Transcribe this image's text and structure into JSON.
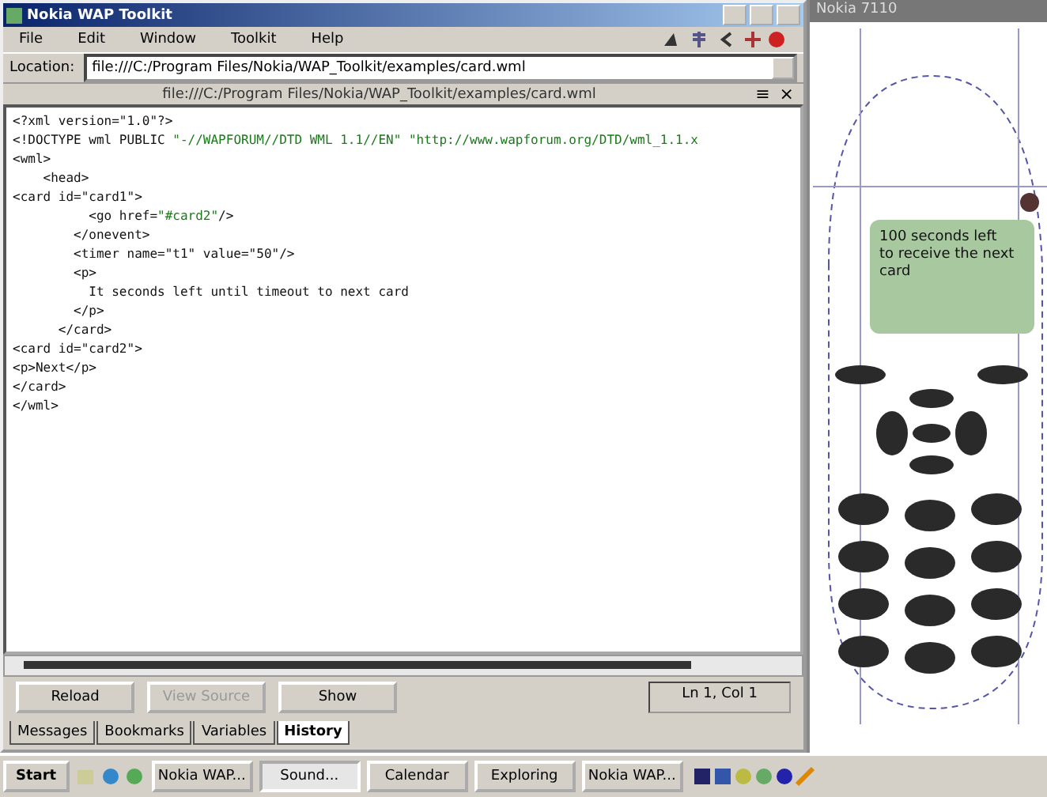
{
  "window": {
    "title": "Nokia WAP Toolkit"
  },
  "menu": [
    "File",
    "Edit",
    "Window",
    "Toolkit",
    "Help"
  ],
  "location": {
    "label": "Location:",
    "value": "file:///C:/Program Files/Nokia/WAP_Toolkit/examples/card.wml"
  },
  "document": {
    "title": "file:///C:/Program Files/Nokia/WAP_Toolkit/examples/card.wml",
    "menu_glyph": "≡",
    "close_glyph": "×"
  },
  "lines": [
    {
      "parts": [
        {
          "kind": "markup",
          "text": "<?xml version=\"1.0\"?>"
        }
      ]
    },
    {
      "parts": [
        {
          "kind": "markup",
          "text": "<!DOCTYPE wml PUBLIC "
        },
        {
          "kind": "string",
          "text": "\"-//WAPFORUM//DTD WML 1.1//EN\" \"http://www.wapforum.org/DTD/wml_1.1.x"
        }
      ]
    },
    {
      "parts": [
        {
          "kind": "markup",
          "text": "<wml>"
        }
      ]
    },
    {
      "parts": [
        {
          "kind": "markup",
          "text": "    <head>"
        }
      ]
    },
    {
      "parts": [
        {
          "kind": "markup",
          "text": "<card id=\"card1\">"
        }
      ]
    },
    {
      "parts": [
        {
          "kind": "markup",
          "text": "          <go href="
        },
        {
          "kind": "string",
          "text": "\"#card2\""
        },
        {
          "kind": "markup",
          "text": "/>"
        }
      ]
    },
    {
      "parts": [
        {
          "kind": "markup",
          "text": "        </onevent>"
        }
      ]
    },
    {
      "parts": [
        {
          "kind": "markup",
          "text": "        <timer name=\"t1\" value=\"50\"/>"
        }
      ]
    },
    {
      "parts": [
        {
          "kind": "markup",
          "text": "        <p>"
        }
      ]
    },
    {
      "parts": [
        {
          "kind": "markup",
          "text": "          It seconds left until timeout to next card"
        }
      ]
    },
    {
      "parts": [
        {
          "kind": "markup",
          "text": "        </p>"
        }
      ]
    },
    {
      "parts": [
        {
          "kind": "markup",
          "text": "      </card>"
        }
      ]
    },
    {
      "parts": [
        {
          "kind": "markup",
          "text": "<card id=\"card2\">"
        }
      ]
    },
    {
      "parts": [
        {
          "kind": "markup",
          "text": "<p>Next</p>"
        }
      ]
    },
    {
      "parts": [
        {
          "kind": "markup",
          "text": "</card>"
        }
      ]
    },
    {
      "parts": [
        {
          "kind": "markup",
          "text": "</wml>"
        }
      ]
    }
  ],
  "buttons": [
    {
      "label": "Reload",
      "disabled": false
    },
    {
      "label": "View Source",
      "disabled": true
    },
    {
      "label": "Show",
      "disabled": false
    }
  ],
  "status": "Ln 1, Col 1",
  "tabs": [
    {
      "label": "Messages",
      "selected": false
    },
    {
      "label": "Bookmarks",
      "selected": false
    },
    {
      "label": "Variables",
      "selected": false
    },
    {
      "label": "History",
      "selected": true
    }
  ],
  "phone": {
    "title": "Nokia 7110",
    "screen_lines": [
      "100 seconds left",
      "to receive the next",
      "card"
    ]
  },
  "taskbar": {
    "start": "Start",
    "tasks": [
      {
        "label": "Nokia WAP...",
        "selected": false
      },
      {
        "label": "Sound...",
        "selected": true
      },
      {
        "label": "Calendar",
        "selected": false
      },
      {
        "label": "Exploring",
        "selected": false
      },
      {
        "label": "Nokia WAP...",
        "selected": false
      }
    ]
  }
}
